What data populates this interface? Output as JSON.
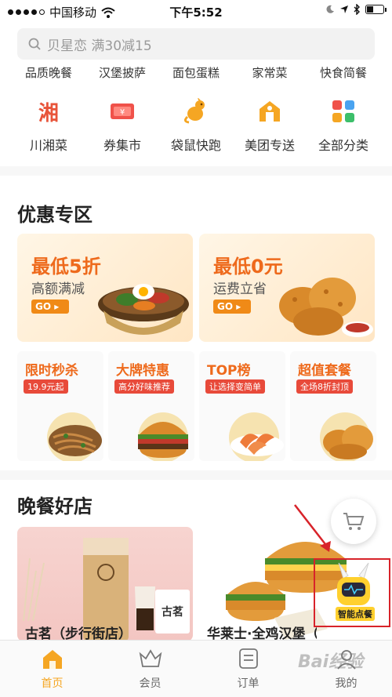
{
  "status_bar": {
    "carrier": "中国移动",
    "time": "下午5:52"
  },
  "search": {
    "placeholder": "贝星恋 满30减15"
  },
  "partial_categories": [
    "品质晚餐",
    "汉堡披萨",
    "面包蛋糕",
    "家常菜",
    "快食简餐"
  ],
  "categories": [
    {
      "label": "川湘菜",
      "icon": "chili-char-icon",
      "glyph": "湘"
    },
    {
      "label": "券集市",
      "icon": "coupon-icon"
    },
    {
      "label": "袋鼠快跑",
      "icon": "kangaroo-icon"
    },
    {
      "label": "美团专送",
      "icon": "delivery-icon"
    },
    {
      "label": "全部分类",
      "icon": "grid-icon"
    }
  ],
  "promo_section": {
    "title": "优惠专区",
    "banners": [
      {
        "title": "最低5折",
        "subtitle": "高额满减",
        "button": "GO"
      },
      {
        "title": "最低0元",
        "subtitle": "运费立省",
        "button": "GO"
      }
    ],
    "deals": [
      {
        "title": "限时秒杀",
        "badge": "19.9元起"
      },
      {
        "title": "大牌特惠",
        "badge": "高分好味推荐"
      },
      {
        "title": "TOP榜",
        "badge": "让选择变简单"
      },
      {
        "title": "超值套餐",
        "badge": "全场8折封顶"
      }
    ]
  },
  "stores_section": {
    "title": "晚餐好店",
    "stores": [
      {
        "name": "古茗（步行街店）",
        "logo_text": "古茗"
      },
      {
        "name": "华莱士·全鸡汉堡（弋..."
      }
    ]
  },
  "assistant": {
    "label": "智能点餐"
  },
  "tabs": [
    {
      "label": "首页",
      "icon": "home-icon",
      "active": true
    },
    {
      "label": "会员",
      "icon": "crown-icon",
      "active": false
    },
    {
      "label": "订单",
      "icon": "order-icon",
      "active": false
    },
    {
      "label": "我的",
      "icon": "profile-icon",
      "active": false
    }
  ],
  "watermark": "Bai经验",
  "colors": {
    "accent": "#f5a623",
    "promo_orange": "#ee6a1c",
    "badge_red": "#e84a3a",
    "highlight_box": "#d8232a"
  }
}
